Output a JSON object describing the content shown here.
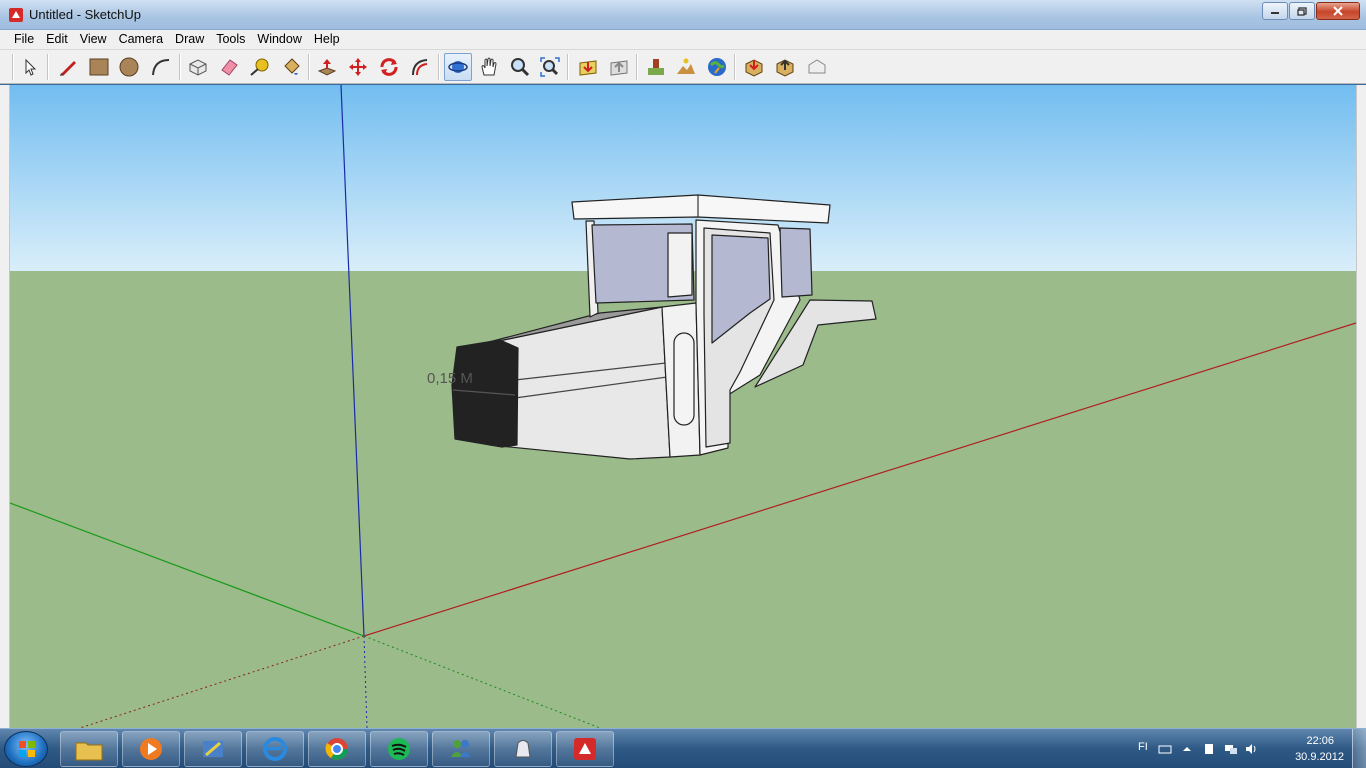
{
  "window": {
    "title": "Untitled - SketchUp"
  },
  "menu": {
    "items": [
      "File",
      "Edit",
      "View",
      "Camera",
      "Draw",
      "Tools",
      "Window",
      "Help"
    ]
  },
  "toolbar": {
    "tools": [
      {
        "name": "select-tool-icon",
        "active": false
      },
      {
        "name": "pencil-line-tool-icon",
        "active": false
      },
      {
        "name": "rectangle-tool-icon",
        "active": false
      },
      {
        "name": "circle-tool-icon",
        "active": false
      },
      {
        "name": "arc-tool-icon",
        "active": false
      },
      {
        "name": "make-component-icon",
        "active": false
      },
      {
        "name": "eraser-tool-icon",
        "active": false
      },
      {
        "name": "tape-measure-tool-icon",
        "active": false
      },
      {
        "name": "paint-bucket-tool-icon",
        "active": false
      },
      {
        "name": "push-pull-tool-icon",
        "active": false
      },
      {
        "name": "move-tool-icon",
        "active": false
      },
      {
        "name": "rotate-tool-icon",
        "active": false
      },
      {
        "name": "offset-tool-icon",
        "active": false
      },
      {
        "name": "orbit-tool-icon",
        "active": true
      },
      {
        "name": "pan-tool-icon",
        "active": false
      },
      {
        "name": "zoom-tool-icon",
        "active": false
      },
      {
        "name": "zoom-extents-icon",
        "active": false
      },
      {
        "name": "get-models-icon",
        "active": false
      },
      {
        "name": "share-model-icon",
        "active": false
      },
      {
        "name": "add-location-icon",
        "active": false
      },
      {
        "name": "toggle-terrain-icon",
        "active": false
      },
      {
        "name": "preview-google-earth-icon",
        "active": false
      },
      {
        "name": "get-components-icon",
        "active": false
      },
      {
        "name": "share-component-icon",
        "active": false
      },
      {
        "name": "extension-warehouse-icon",
        "active": false
      }
    ]
  },
  "viewport": {
    "measurement_label": "0,15 M",
    "colors": {
      "sky": "#87c7f0",
      "ground": "#9bbb8b",
      "red_axis": "#b02020",
      "green_axis": "#1a9a1a",
      "blue_axis": "#1a2aa8"
    }
  },
  "taskbar": {
    "apps": [
      {
        "name": "windows-explorer-icon"
      },
      {
        "name": "media-player-icon"
      },
      {
        "name": "network-tool-icon"
      },
      {
        "name": "internet-explorer-icon"
      },
      {
        "name": "chrome-icon"
      },
      {
        "name": "spotify-icon"
      },
      {
        "name": "messenger-icon"
      },
      {
        "name": "utility-app-icon"
      },
      {
        "name": "sketchup-icon"
      }
    ],
    "tray": {
      "lang": "FI",
      "time": "22:06",
      "date": "30.9.2012"
    }
  }
}
